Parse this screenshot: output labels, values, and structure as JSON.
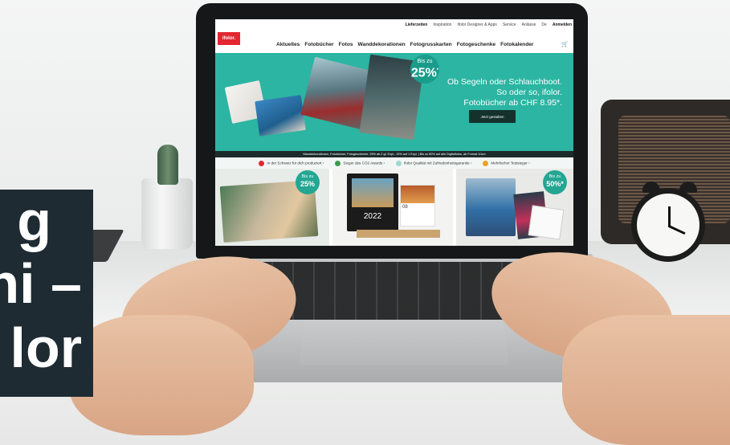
{
  "overlay_title": {
    "lines": [
      "g",
      "ni –",
      "lor"
    ]
  },
  "website": {
    "logo": "ifolor.",
    "top_nav": [
      "Lieferzeiten",
      "Inspiration",
      "ifolor Designer & Apps",
      "Service",
      "Anlässe",
      "De",
      "Anmelden"
    ],
    "main_nav": [
      "Aktuelles",
      "Fotobücher",
      "Fotos",
      "Wanddekorationen",
      "Fotogrusskarten",
      "Fotogeschenke",
      "Fotokalender"
    ],
    "hero": {
      "badge_small": "Bis zu",
      "badge_big": "25%",
      "badge_sup": "*",
      "line1": "Ob Segeln oder Schlauchboot.",
      "line2": "So oder so, ifolor.",
      "line3": "Fotobücher ab CHF 8.95*.",
      "button": "Jetzt gestalten"
    },
    "promo_strip": "Wanddekorationen, Fotobücher, Fotogeschenke: 25% ab 2 gl. Expl., 10% auf 1 Expl. | Bis zu 50% auf alle Digitalfotos, ab Format 10cm",
    "usps": [
      {
        "text": "In der Schweiz für dich produziert",
        "color": "#e3262f"
      },
      {
        "text": "Sieger des CO2 Awards",
        "color": "#3e9b4f"
      },
      {
        "text": "ifolor Qualität mit Zufriedenheitsgarantie",
        "color": "#9fd8d0"
      },
      {
        "text": "Mehrfacher Testsieger",
        "color": "#f0a21c"
      }
    ],
    "tiles": [
      {
        "badge_small": "Bis zu",
        "badge_big": "25%"
      },
      {
        "calendar_year": "2022",
        "calendar_month": "08"
      },
      {
        "badge_small": "Bis zu",
        "badge_big": "50%*"
      }
    ]
  },
  "colors": {
    "hero_teal": "#2bb5a2",
    "logo_red": "#e3262f",
    "overlay_dark": "#1f2b33"
  }
}
